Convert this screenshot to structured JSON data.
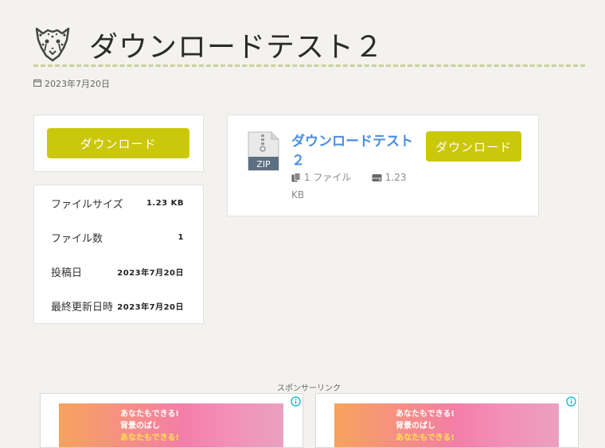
{
  "header": {
    "title": "ダウンロードテスト２",
    "date": "2023年7月20日"
  },
  "left_panel": {
    "download_label": "ダウンロード"
  },
  "info": {
    "rows": [
      {
        "label": "ファイルサイズ",
        "value": "1.23 KB"
      },
      {
        "label": "ファイル数",
        "value": "1"
      },
      {
        "label": "投稿日",
        "value": "2023年7月20日"
      },
      {
        "label": "最終更新日時",
        "value": "2023年7月20日"
      }
    ]
  },
  "file_card": {
    "icon_label": "ZIP",
    "name": "ダウンロードテスト２",
    "file_count": "1 ファイル",
    "size": "1.23 KB",
    "download_label": "ダウンロード"
  },
  "sponsor": {
    "label": "スポンサーリンク",
    "ads": [
      {
        "line1": "あなたもできる!",
        "line2": "背景のばし",
        "line3": "あなたもできる!"
      },
      {
        "line1": "あなたもできる!",
        "line2": "背景のばし",
        "line3": "あなたもできる!"
      }
    ]
  },
  "colors": {
    "accent": "#cbc70a",
    "link": "#4a8ee0",
    "rule": "#c9d19a",
    "background": "#f3f2ef"
  },
  "icons": [
    "cheetah-logo-icon",
    "calendar-icon",
    "zip-file-icon",
    "files-icon",
    "storage-icon",
    "ad-info-icon"
  ]
}
